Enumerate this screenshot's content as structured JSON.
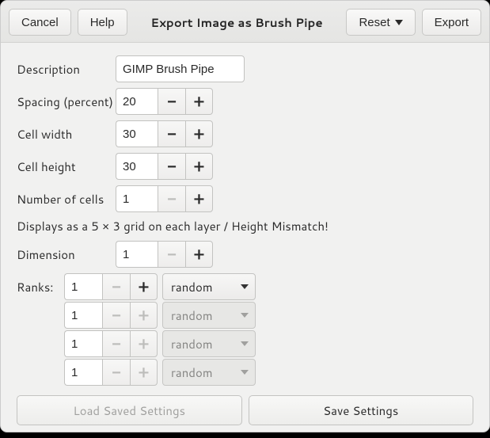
{
  "header": {
    "cancel": "Cancel",
    "help": "Help",
    "title": "Export Image as Brush Pipe",
    "reset": "Reset",
    "export": "Export"
  },
  "labels": {
    "description": "Description",
    "spacing": "Spacing (percent)",
    "cell_width": "Cell width",
    "cell_height": "Cell height",
    "num_cells": "Number of cells",
    "dimension": "Dimension",
    "ranks": "Ranks:"
  },
  "values": {
    "description": "GIMP Brush Pipe",
    "spacing": "20",
    "cell_width": "30",
    "cell_height": "30",
    "num_cells": "1",
    "dimension": "1"
  },
  "status": "Displays as a 5 × 3 grid on each layer / Height Mismatch!",
  "ranks": [
    {
      "value": "1",
      "mode": "random",
      "enabled": true
    },
    {
      "value": "1",
      "mode": "random",
      "enabled": false
    },
    {
      "value": "1",
      "mode": "random",
      "enabled": false
    },
    {
      "value": "1",
      "mode": "random",
      "enabled": false
    }
  ],
  "footer": {
    "load": "Load Saved Settings",
    "save": "Save Settings"
  },
  "glyphs": {
    "minus": "−",
    "plus": "+"
  }
}
